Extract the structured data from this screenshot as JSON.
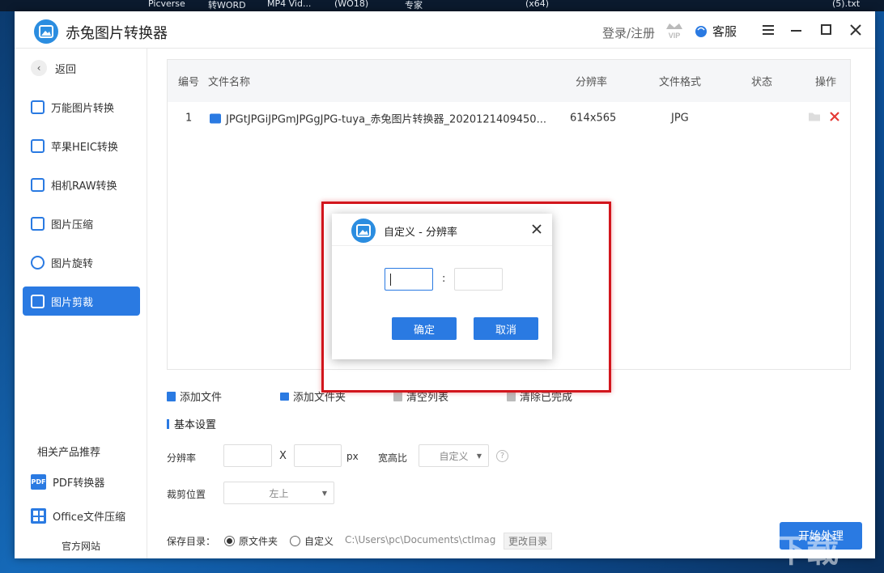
{
  "taskbar": [
    "Picverse",
    "转WORD",
    "MP4 Vid...",
    "(WO18)",
    "专家",
    "(x64)",
    "(5).txt"
  ],
  "app": {
    "title": "赤兔图片转换器",
    "login": "登录/注册",
    "vip": "VIP",
    "service": "客服"
  },
  "sidebar": {
    "back": "返回",
    "items": [
      {
        "label": "万能图片转换"
      },
      {
        "label": "苹果HEIC转换"
      },
      {
        "label": "相机RAW转换"
      },
      {
        "label": "图片压缩"
      },
      {
        "label": "图片旋转"
      },
      {
        "label": "图片剪裁"
      }
    ],
    "recommend_title": "相关产品推荐",
    "recommend": [
      {
        "label": "PDF转换器",
        "badge": "PDF"
      },
      {
        "label": "Office文件压缩"
      }
    ],
    "official": "官方网站"
  },
  "table": {
    "headers": {
      "no": "编号",
      "name": "文件名称",
      "res": "分辨率",
      "fmt": "文件格式",
      "status": "状态",
      "op": "操作"
    },
    "rows": [
      {
        "no": "1",
        "name": "JPGtJPGiJPGmJPGgJPG-tuya_赤兔图片转换器_2020121409450...",
        "res": "614x565",
        "fmt": "JPG",
        "status": ""
      }
    ]
  },
  "actions": {
    "add_file": "添加文件",
    "add_folder": "添加文件夹",
    "clear_list": "清空列表",
    "clear_done": "清除已完成"
  },
  "settings": {
    "title": "基本设置",
    "resolution_label": "分辨率",
    "x": "X",
    "px": "px",
    "ratio_label": "宽高比",
    "ratio_value": "自定义",
    "help": "?",
    "crop_label": "裁剪位置",
    "crop_value": "左上"
  },
  "save": {
    "label": "保存目录：",
    "option_original": "原文件夹",
    "option_custom": "自定义",
    "path": "C:\\Users\\pc\\Documents\\ctImag",
    "change": "更改目录",
    "start": "开始处理"
  },
  "dialog": {
    "title": "自定义 - 分辨率",
    "colon": ":",
    "ok": "确定",
    "cancel": "取消"
  },
  "watermark": "下载",
  "colors": {
    "accent": "#2a7ae2",
    "highlight": "#d2161d",
    "delete": "#e53935"
  }
}
